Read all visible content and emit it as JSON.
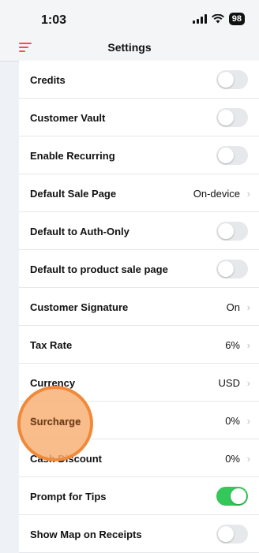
{
  "status_bar": {
    "time": "1:03",
    "battery": "98",
    "signal_icon": "signal-icon",
    "wifi_icon": "wifi-icon"
  },
  "nav": {
    "title": "Settings",
    "menu_icon": "menu-icon"
  },
  "rows": [
    {
      "label": "Credits",
      "type": "toggle",
      "on": false
    },
    {
      "label": "Customer Vault",
      "type": "toggle",
      "on": false
    },
    {
      "label": "Enable Recurring",
      "type": "toggle",
      "on": false
    },
    {
      "label": "Default Sale Page",
      "type": "value",
      "value": "On-device"
    },
    {
      "label": "Default to Auth-Only",
      "type": "toggle",
      "on": false
    },
    {
      "label": "Default to product sale page",
      "type": "toggle",
      "on": false
    },
    {
      "label": "Customer Signature",
      "type": "value",
      "value": "On"
    },
    {
      "label": "Tax Rate",
      "type": "value",
      "value": "6%"
    },
    {
      "label": "Currency",
      "type": "value",
      "value": "USD"
    },
    {
      "label": "Surcharge",
      "type": "value",
      "value": "0%"
    },
    {
      "label": "Cash Discount",
      "type": "value",
      "value": "0%"
    },
    {
      "label": "Prompt for Tips",
      "type": "toggle",
      "on": true
    },
    {
      "label": "Show Map on Receipts",
      "type": "toggle",
      "on": false
    }
  ],
  "colors": {
    "accent": "#f0504e",
    "toggle_on": "#34c759",
    "highlight": "#f08a3a"
  }
}
